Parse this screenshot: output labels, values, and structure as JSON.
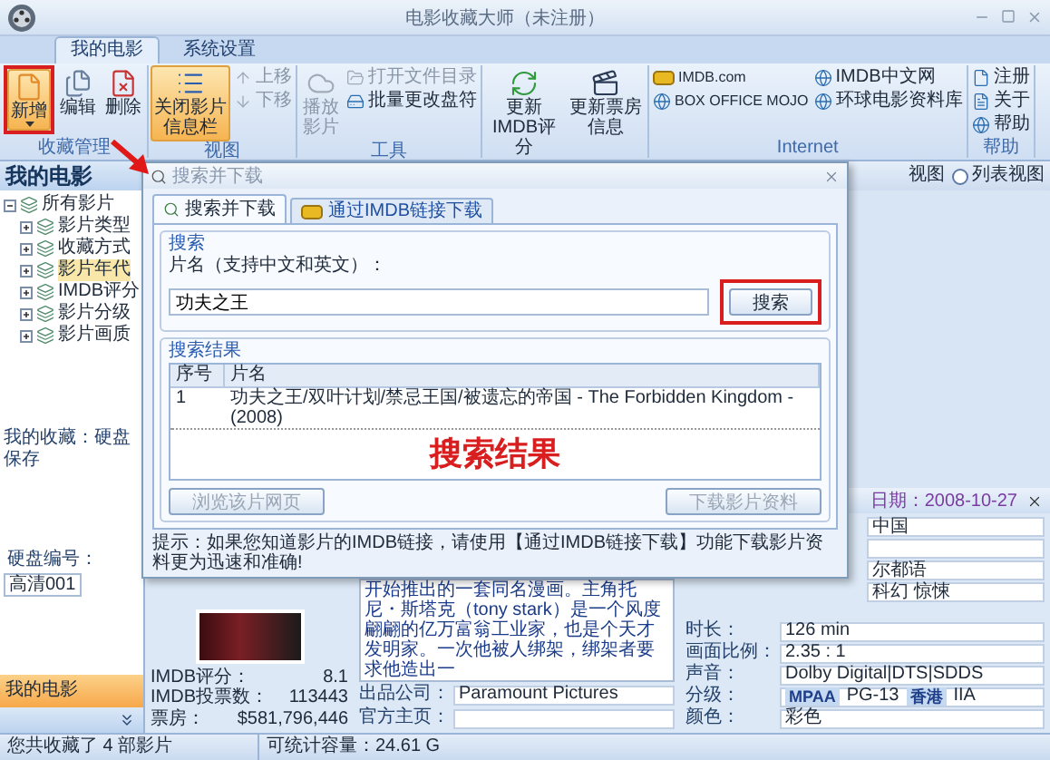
{
  "window": {
    "title": "电影收藏大师（未注册）"
  },
  "ribbon_tabs": [
    {
      "label": "我的电影",
      "selected": true
    },
    {
      "label": "系统设置",
      "selected": false
    }
  ],
  "ribbon_groups": [
    {
      "label": "收藏管理",
      "columns": [
        {
          "kind": "large",
          "label": "新增",
          "on": true,
          "annotated": true,
          "dropdown": true,
          "disabled": false
        },
        {
          "kind": "large",
          "label": "编辑",
          "on": false,
          "annotated": false,
          "dropdown": false,
          "disabled": false
        },
        {
          "kind": "large",
          "label": "删除",
          "on": false,
          "annotated": false,
          "dropdown": false,
          "disabled": false
        }
      ]
    },
    {
      "label": "视图",
      "columns": [
        {
          "kind": "large",
          "label": "关闭影片信息栏",
          "on": true,
          "annotated": false,
          "dropdown": false,
          "disabled": false
        },
        {
          "kind": "stack",
          "items": [
            {
              "label": "上移",
              "disabled": true
            },
            {
              "label": "下移",
              "disabled": true
            }
          ]
        }
      ]
    },
    {
      "label": "工具",
      "columns": [
        {
          "kind": "large",
          "label": "播放影片",
          "on": false,
          "annotated": false,
          "dropdown": false,
          "disabled": true
        },
        {
          "kind": "stack",
          "items": [
            {
              "label": "打开文件目录",
              "disabled": true
            },
            {
              "label": "批量更改盘符",
              "disabled": false
            }
          ]
        }
      ]
    },
    {
      "columns": [
        {
          "kind": "large",
          "label": "更新IMDB评分",
          "on": false,
          "annotated": false,
          "dropdown": false,
          "disabled": false
        },
        {
          "kind": "large",
          "label": "更新票房信息",
          "on": false,
          "annotated": false,
          "dropdown": false,
          "disabled": false
        }
      ]
    },
    {
      "label": "Internet",
      "columns": [
        {
          "kind": "stack",
          "items": [
            {
              "label": "IMDB.com",
              "disabled": false
            },
            {
              "label": "BOX OFFICE MOJO",
              "disabled": false
            }
          ]
        },
        {
          "kind": "stack",
          "items": [
            {
              "label": "IMDB中文网",
              "disabled": false
            },
            {
              "label": "环球电影资料库",
              "disabled": false
            }
          ]
        }
      ]
    },
    {
      "label": "帮助",
      "columns": [
        {
          "kind": "stack",
          "items": [
            {
              "label": "注册",
              "disabled": false
            },
            {
              "label": "关于",
              "disabled": false
            },
            {
              "label": "帮助",
              "disabled": false
            }
          ]
        }
      ]
    }
  ],
  "left_panel": {
    "title": "我的电影",
    "tree": [
      {
        "label": "所有影片",
        "expanded": true,
        "selected": false,
        "children": [
          {
            "label": "影片类型",
            "expanded": false,
            "selected": false
          },
          {
            "label": "收藏方式",
            "expanded": false,
            "selected": false
          },
          {
            "label": "影片年代",
            "expanded": false,
            "selected": true
          },
          {
            "label": "IMDB评分",
            "expanded": false,
            "selected": false
          },
          {
            "label": "影片分级",
            "expanded": false,
            "selected": false
          },
          {
            "label": "影片画质",
            "expanded": false,
            "selected": false
          }
        ]
      }
    ],
    "collection": "我的收藏：硬盘保存",
    "disk": {
      "label": "硬盘编号：",
      "value": "高清001"
    },
    "nav": {
      "label": "我的电影",
      "selected": true
    }
  },
  "view_bar": {
    "label": "视图",
    "radio": {
      "label": "列表视图",
      "selected": false
    }
  },
  "detail": {
    "date": "日期：2008-10-27",
    "stats": [
      {
        "label": "IMDB评分：",
        "value": "8.1"
      },
      {
        "label": "IMDB投票数：",
        "value": "113443"
      },
      {
        "label": "票房：",
        "value": "$581,796,446"
      }
    ],
    "description": "开始推出的一套同名漫画。主角托尼・斯塔克（tony stark）是一个风度翩翩的亿万富翁工业家，也是个天才发明家。一次他被人绑架，绑架者要求他造出一",
    "company": {
      "label": "出品公司：",
      "value": "Paramount Pictures"
    },
    "homepage": {
      "label": "官方主页："
    },
    "rows": [
      {
        "kind": "value-only",
        "value": "中国"
      },
      {
        "kind": "blank"
      },
      {
        "kind": "value-only",
        "value": "尔都语"
      },
      {
        "kind": "value-only",
        "value": "科幻 惊悚"
      },
      {
        "kind": "field",
        "label": "时长：",
        "value": "126 min"
      },
      {
        "kind": "field",
        "label": "画面比例：",
        "value": "2.35 : 1"
      },
      {
        "kind": "field",
        "label": "声音：",
        "value": "Dolby Digital|DTS|SDDS"
      },
      {
        "kind": "rating",
        "label": "分级：",
        "systems": [
          {
            "name": "MPAA",
            "value": "PG-13"
          },
          {
            "name": "香港",
            "value": "IIA"
          }
        ]
      },
      {
        "kind": "field",
        "label": "颜色：",
        "value": "彩色"
      }
    ]
  },
  "dialog": {
    "title": "搜索并下载",
    "tabs": [
      {
        "label": "搜索并下载",
        "selected": true
      },
      {
        "label": "通过IMDB链接下载",
        "selected": false
      }
    ],
    "search": {
      "legend": "搜索",
      "label": "片名（支持中文和英文）：",
      "value": "功夫之王",
      "button": {
        "label": "搜索",
        "annotated": true
      }
    },
    "results": {
      "legend": "搜索结果",
      "columns": [
        "序号",
        "片名"
      ],
      "rows": [
        {
          "cells": [
            "1",
            "功夫之王/双叶计划/禁忌王国/被遗忘的帝国 - The Forbidden Kingdom - (2008)"
          ],
          "selected": false
        }
      ],
      "annotation": "搜索结果",
      "buttons": [
        {
          "label": "浏览该片网页",
          "disabled": true
        },
        {
          "label": "下载影片资料",
          "disabled": true
        }
      ]
    },
    "hint": "提示：如果您知道影片的IMDB链接，请使用【通过IMDB链接下载】功能下载影片资料更为迅速和准确!"
  },
  "status_bar": [
    "您共收藏了 4 部影片",
    "可统计容量：24.61 G"
  ]
}
